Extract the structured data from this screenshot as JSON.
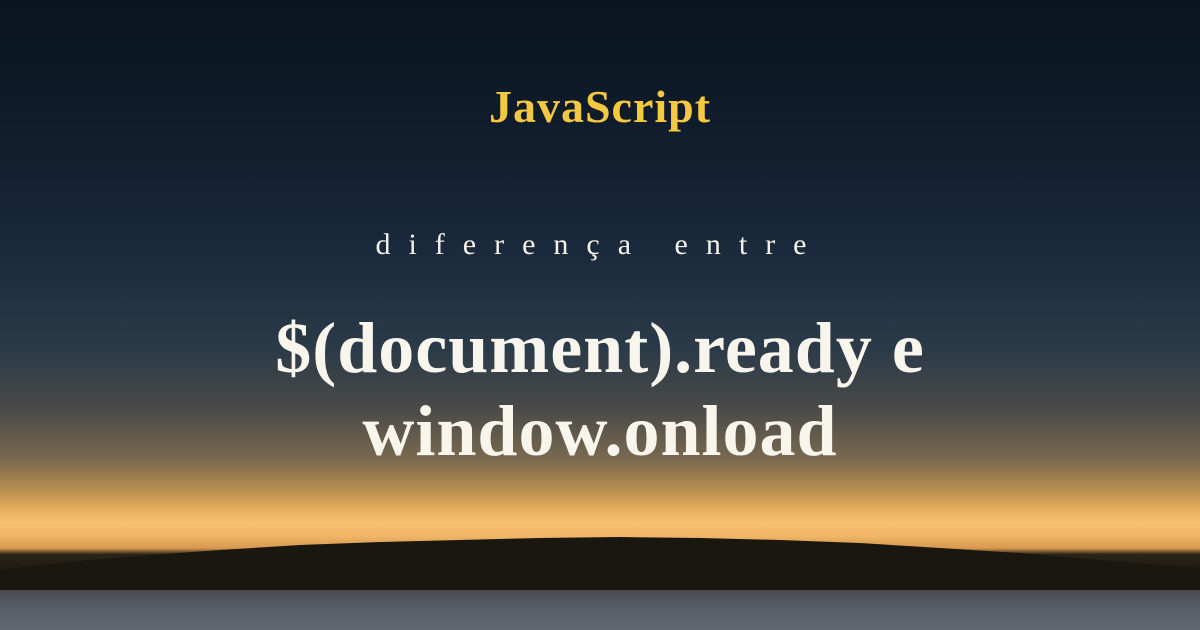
{
  "title": "JavaScript",
  "subtitle": "diferença entre",
  "main_line1": "$(document).ready e",
  "main_line2": "window.onload"
}
